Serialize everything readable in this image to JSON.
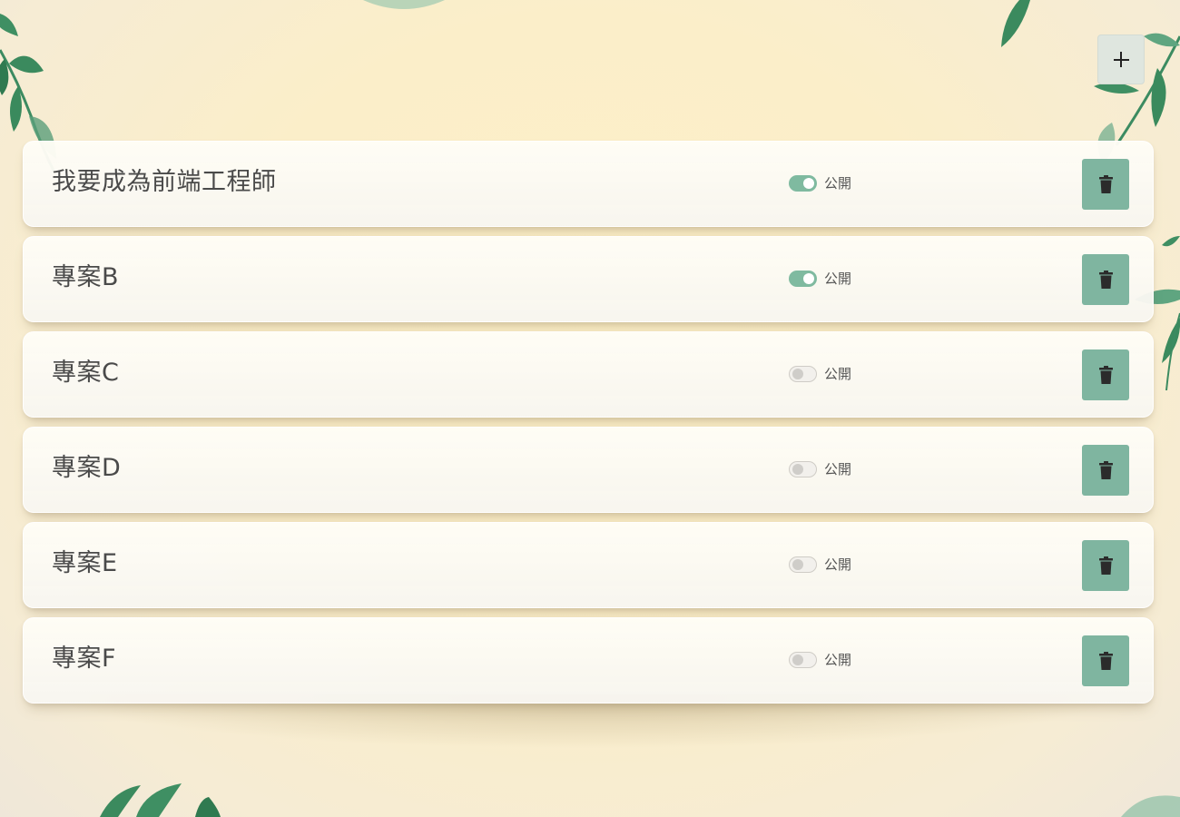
{
  "toolbar": {
    "add_label": "+"
  },
  "colors": {
    "accent": "#7fb5a0",
    "toggle_on": "#7fbaa0",
    "background": "#fbeec9"
  },
  "items": [
    {
      "title": "我要成為前端工程師",
      "public_label": "公開",
      "is_public": true
    },
    {
      "title": "專案B",
      "public_label": "公開",
      "is_public": true
    },
    {
      "title": "專案C",
      "public_label": "公開",
      "is_public": false
    },
    {
      "title": "專案D",
      "public_label": "公開",
      "is_public": false
    },
    {
      "title": "專案E",
      "public_label": "公開",
      "is_public": false
    },
    {
      "title": "專案F",
      "public_label": "公開",
      "is_public": false
    }
  ]
}
